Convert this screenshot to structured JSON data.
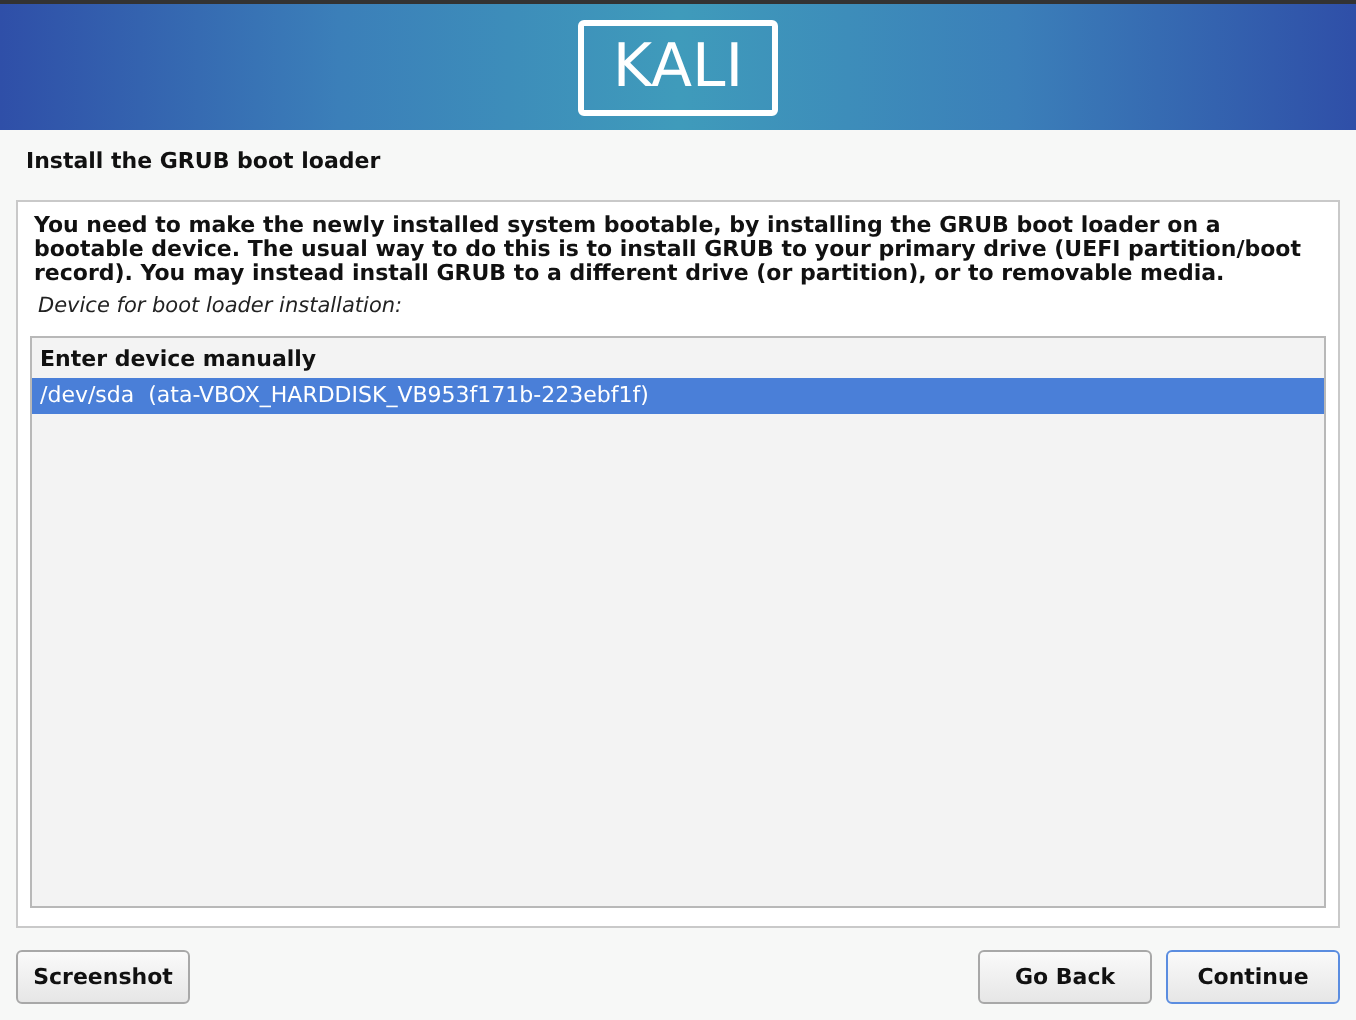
{
  "header": {
    "logo": "KALI"
  },
  "title": "Install the GRUB boot loader",
  "description": "You need to make the newly installed system bootable, by installing the GRUB boot loader on a bootable device. The usual way to do this is to install GRUB to your primary drive (UEFI partition/boot record). You may instead install GRUB to a different drive (or partition), or to removable media.",
  "prompt": "Device for boot loader installation:",
  "options": [
    {
      "label": "Enter device manually",
      "kind": "manual",
      "selected": false
    },
    {
      "label": "/dev/sda  (ata-VBOX_HARDDISK_VB953f171b-223ebf1f)",
      "kind": "device",
      "selected": true
    }
  ],
  "buttons": {
    "left": [
      "Screenshot"
    ],
    "right": [
      {
        "label": "Go Back",
        "focused": false
      },
      {
        "label": "Continue",
        "focused": true
      }
    ]
  }
}
